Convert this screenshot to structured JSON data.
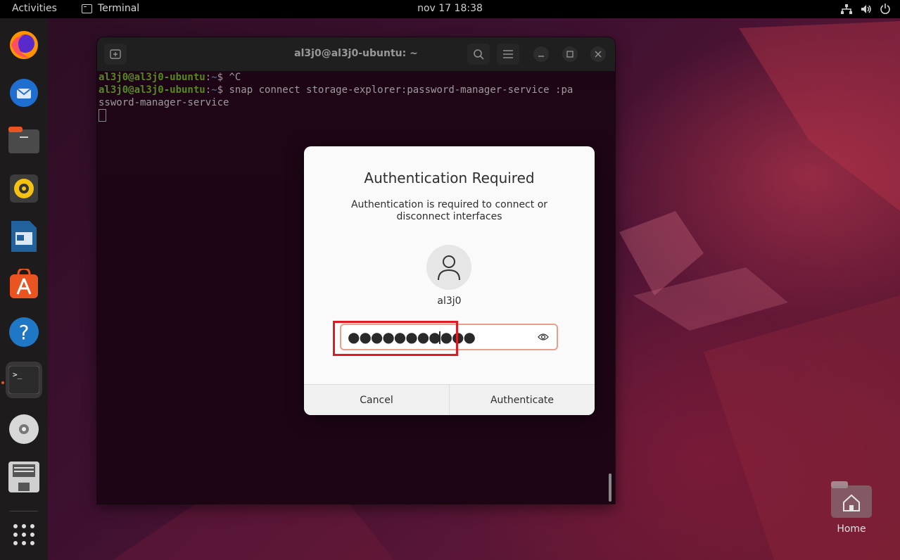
{
  "topbar": {
    "activities": "Activities",
    "app_name": "Terminal",
    "clock": "nov 17  18:38"
  },
  "dock": {
    "items": [
      "firefox-icon",
      "thunderbird-icon",
      "files-icon",
      "rhythmbox-icon",
      "libreoffice-writer-icon",
      "app-center-icon",
      "help-icon",
      "terminal-icon",
      "disc-icon",
      "floppy-save-icon",
      "show-apps-grid-icon"
    ]
  },
  "terminal": {
    "title": "al3j0@al3j0-ubuntu: ~",
    "lines": [
      {
        "user": "al3j0@al3j0-ubuntu",
        "path": "~",
        "cmd": "$ ^C"
      },
      {
        "user": "al3j0@al3j0-ubuntu",
        "path": "~",
        "cmd": "$ snap connect storage-explorer:password-manager-service :pa"
      }
    ],
    "wrap_line": "ssword-manager-service"
  },
  "dialog": {
    "title": "Authentication Required",
    "message": "Authentication is required to connect or disconnect interfaces",
    "username": "al3j0",
    "password_mask": "●●●●●●●●●●●",
    "cancel": "Cancel",
    "authenticate": "Authenticate"
  },
  "desktop": {
    "home_label": "Home"
  },
  "colors": {
    "accent": "#e95420",
    "highlight": "#e01b24",
    "prompt_user": "#8ae234",
    "prompt_path": "#729fcf"
  }
}
